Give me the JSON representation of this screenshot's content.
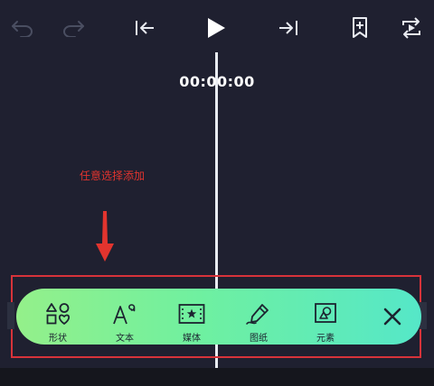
{
  "timecode": "00:00:00",
  "annotation": "任意选择添加",
  "add_bar": {
    "items": [
      {
        "label": "形状",
        "icon": "shapes-icon"
      },
      {
        "label": "文本",
        "icon": "text-icon"
      },
      {
        "label": "媒体",
        "icon": "media-icon"
      },
      {
        "label": "图纸",
        "icon": "drawing-icon"
      },
      {
        "label": "元素",
        "icon": "element-icon"
      }
    ],
    "close_icon": "close-icon"
  },
  "colors": {
    "background": "#1f2030",
    "annotation": "#e2342e",
    "bar_gradient_start": "#94f08a",
    "bar_gradient_end": "#55e7c8"
  }
}
